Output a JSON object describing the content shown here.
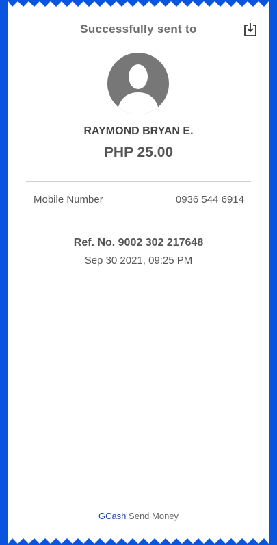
{
  "header": {
    "title": "Successfully sent to",
    "download_icon": "download-icon"
  },
  "recipient": {
    "name": "RAYMOND BRYAN E.",
    "amount": "PHP 25.00",
    "avatar_icon": "person-avatar-icon"
  },
  "details": {
    "mobile_label": "Mobile Number",
    "mobile_value": "0936 544 6914"
  },
  "reference": {
    "ref_text": "Ref. No. 9002 302 217648",
    "datetime": "Sep 30 2021, 09:25 PM"
  },
  "footer": {
    "brand": "GCash",
    "label": "Send Money"
  },
  "colors": {
    "background": "#0a55e0",
    "receipt": "#ffffff",
    "avatar": "#777777",
    "brand": "#1a4aa8"
  }
}
